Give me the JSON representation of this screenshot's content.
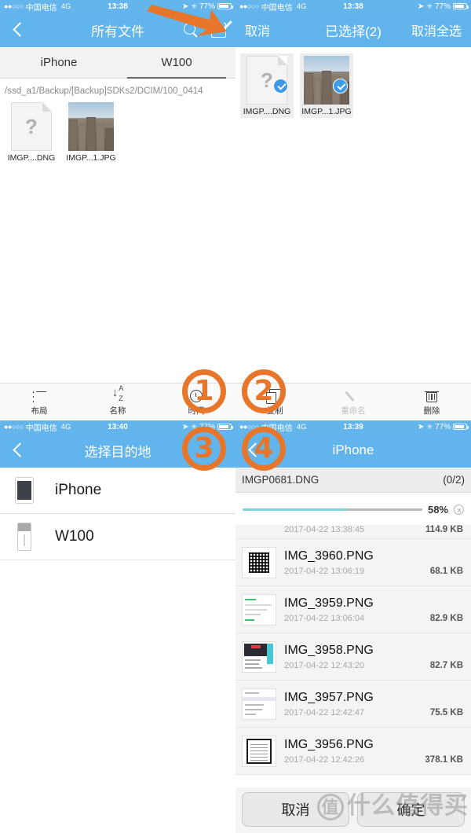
{
  "panel1": {
    "status": {
      "dots": "●●○○○",
      "carrier": "中国电信",
      "network": "4G",
      "time": "13:38",
      "battery": "77%"
    },
    "nav": {
      "title": "所有文件",
      "back_icon": "chevron-left-icon",
      "search_icon": "search-icon",
      "edit_icon": "compose-edit-icon"
    },
    "tabs": [
      {
        "label": "iPhone",
        "active": false
      },
      {
        "label": "W100",
        "active": true
      }
    ],
    "path": "/ssd_a1/Backup/[Backup]SDKs2/DCIM/100_0414",
    "files": [
      {
        "label": "IMGP....DNG",
        "kind": "unknown-file"
      },
      {
        "label": "IMGP...1.JPG",
        "kind": "photo"
      }
    ],
    "toolbar": [
      {
        "label": "布局",
        "icon": "layout-icon",
        "disabled": false
      },
      {
        "label": "名称",
        "icon": "sort-az-icon",
        "disabled": false
      },
      {
        "label": "时间",
        "icon": "clock-icon",
        "disabled": false
      }
    ]
  },
  "panel2": {
    "status": {
      "dots": "●●○○○",
      "carrier": "中国电信",
      "network": "4G",
      "time": "13:38",
      "battery": "77%"
    },
    "nav": {
      "cancel": "取消",
      "title": "已选择(2)",
      "deselect_all": "取消全选"
    },
    "files": [
      {
        "label": "IMGP....DNG",
        "kind": "unknown-file",
        "selected": true
      },
      {
        "label": "IMGP...1.JPG",
        "kind": "photo",
        "selected": true
      }
    ],
    "toolbar": [
      {
        "label": "复制",
        "icon": "copy-icon",
        "disabled": false
      },
      {
        "label": "重命名",
        "icon": "pencil-icon",
        "disabled": true
      },
      {
        "label": "删除",
        "icon": "trash-icon",
        "disabled": false
      }
    ]
  },
  "panel3": {
    "status": {
      "dots": "●●○○○",
      "carrier": "中国电信",
      "network": "4G",
      "time": "13:40",
      "battery": "77%"
    },
    "nav": {
      "title": "选择目的地",
      "back_icon": "chevron-left-icon"
    },
    "destinations": [
      {
        "label": "iPhone",
        "icon": "iphone-device-icon"
      },
      {
        "label": "W100",
        "icon": "usb-drive-icon"
      }
    ]
  },
  "panel4": {
    "status": {
      "dots": "●●○○○",
      "carrier": "中国电信",
      "network": "4G",
      "time": "13:39",
      "battery": "77%"
    },
    "nav": {
      "title": "iPhone",
      "back_icon": "chevron-left-icon"
    },
    "transfer": {
      "filename": "IMGP0681.DNG",
      "count": "(0/2)",
      "percent": "58%",
      "progress": 58,
      "cancel_icon": "close-circle-icon"
    },
    "files": [
      {
        "name": "",
        "date": "2017-04-22 13:38:45",
        "size": "114.9 KB",
        "thumb": "partial",
        "partial": true
      },
      {
        "name": "IMG_3960.PNG",
        "date": "2017-04-22 13:06:19",
        "size": "68.1 KB",
        "thumb": "qr"
      },
      {
        "name": "IMG_3959.PNG",
        "date": "2017-04-22 13:06:04",
        "size": "82.9 KB",
        "thumb": "chat"
      },
      {
        "name": "IMG_3958.PNG",
        "date": "2017-04-22 12:43:20",
        "size": "82.7 KB",
        "thumb": "card"
      },
      {
        "name": "IMG_3957.PNG",
        "date": "2017-04-22 12:42:47",
        "size": "75.5 KB",
        "thumb": "list"
      },
      {
        "name": "IMG_3956.PNG",
        "date": "2017-04-22 12:42:26",
        "size": "378.1 KB",
        "thumb": "doc"
      }
    ],
    "buttons": {
      "cancel": "取消",
      "confirm": "确定"
    }
  },
  "annotations": {
    "numbers": [
      "1",
      "2",
      "3",
      "4"
    ],
    "arrow": "orange-arrow-pointing-to-edit-icon",
    "accent_color": "#e8762a"
  },
  "watermark": {
    "circle": "值",
    "text": "什么值得买"
  }
}
